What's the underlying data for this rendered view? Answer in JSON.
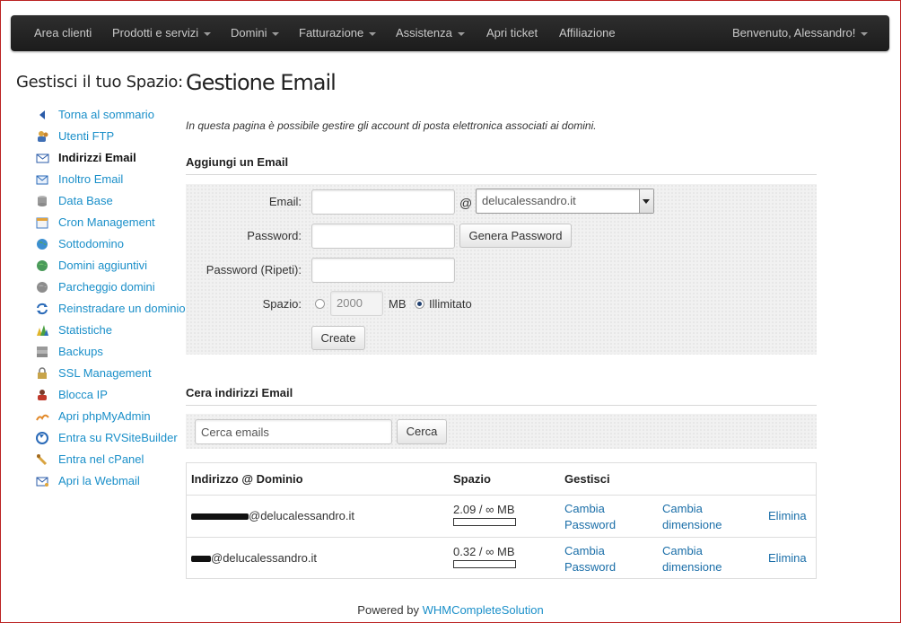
{
  "navbar": {
    "items": [
      {
        "label": "Area clienti",
        "dropdown": false
      },
      {
        "label": "Prodotti e servizi",
        "dropdown": true
      },
      {
        "label": "Domini",
        "dropdown": true
      },
      {
        "label": "Fatturazione",
        "dropdown": true
      },
      {
        "label": "Assistenza",
        "dropdown": true
      },
      {
        "label": "Apri ticket",
        "dropdown": false
      },
      {
        "label": "Affiliazione",
        "dropdown": false
      }
    ],
    "user": "Benvenuto, Alessandro!"
  },
  "sidebar": {
    "title": "Gestisci il tuo Spazio:",
    "items": [
      {
        "label": "Torna al sommario",
        "icon": "back-arrow-icon",
        "active": false
      },
      {
        "label": "Utenti FTP",
        "icon": "ftp-users-icon",
        "active": false
      },
      {
        "label": "Indirizzi Email",
        "icon": "envelope-icon",
        "active": true
      },
      {
        "label": "Inoltro Email",
        "icon": "forward-email-icon",
        "active": false
      },
      {
        "label": "Data Base",
        "icon": "database-icon",
        "active": false
      },
      {
        "label": "Cron Management",
        "icon": "calendar-icon",
        "active": false
      },
      {
        "label": "Sottodomino",
        "icon": "globe-icon",
        "active": false
      },
      {
        "label": "Domini aggiuntivi",
        "icon": "globe-add-icon",
        "active": false
      },
      {
        "label": "Parcheggio domini",
        "icon": "parked-globe-icon",
        "active": false
      },
      {
        "label": "Reinstradare un dominio",
        "icon": "redirect-arrows-icon",
        "active": false
      },
      {
        "label": "Statistiche",
        "icon": "stats-chart-icon",
        "active": false
      },
      {
        "label": "Backups",
        "icon": "backup-icon",
        "active": false
      },
      {
        "label": "SSL Management",
        "icon": "ssl-icon",
        "active": false
      },
      {
        "label": "Blocca IP",
        "icon": "block-user-icon",
        "active": false
      },
      {
        "label": "Apri phpMyAdmin",
        "icon": "phpmyadmin-icon",
        "active": false
      },
      {
        "label": "Entra su RVSiteBuilder",
        "icon": "sitebuilder-icon",
        "active": false
      },
      {
        "label": "Entra nel cPanel",
        "icon": "cpanel-icon",
        "active": false
      },
      {
        "label": "Apri la Webmail",
        "icon": "webmail-icon",
        "active": false
      }
    ]
  },
  "main": {
    "title": "Gestione Email",
    "intro": "In questa pagina è possibile gestire gli account di posta elettronica associati ai domini.",
    "add_section": {
      "heading": "Aggiungi un Email",
      "email_label": "Email:",
      "email_value": "",
      "at_sign": "@",
      "domain_selected": "delucalessandro.it",
      "password_label": "Password:",
      "password_value": "",
      "generate_label": "Genera Password",
      "password_repeat_label": "Password (Ripeti):",
      "space_label": "Spazio:",
      "space_value": "2000",
      "space_unit": "MB",
      "unlimited_label": "Illimitato",
      "unlimited_selected": true,
      "create_label": "Create"
    },
    "search_section": {
      "heading": "Cera indirizzi Email",
      "placeholder": "Cerca emails",
      "button_label": "Cerca"
    },
    "table": {
      "headers": [
        "Indirizzo @ Dominio",
        "Spazio",
        "Gestisci"
      ],
      "rows": [
        {
          "address": "@delucalessandro.it",
          "usage": "2.09 / ∞ MB",
          "usage_fraction": 0,
          "change_password": "Cambia Password",
          "change_size": "Cambia dimensione",
          "delete": "Elimina"
        },
        {
          "address": "@delucalessandro.it",
          "usage": "0.32 / ∞ MB",
          "usage_fraction": 0,
          "change_password": "Cambia Password",
          "change_size": "Cambia dimensione",
          "delete": "Elimina"
        }
      ],
      "change_password_line1": "Cambia",
      "change_password_line2": "Password",
      "change_size_line1": "Cambia",
      "change_size_line2": "dimensione"
    }
  },
  "footer": {
    "prefix": "Powered by",
    "link": "WHMCompleteSolution"
  },
  "colors": {
    "link": "#1a8fc9",
    "navbar": "#222222",
    "accent": "#1a6ea8"
  }
}
